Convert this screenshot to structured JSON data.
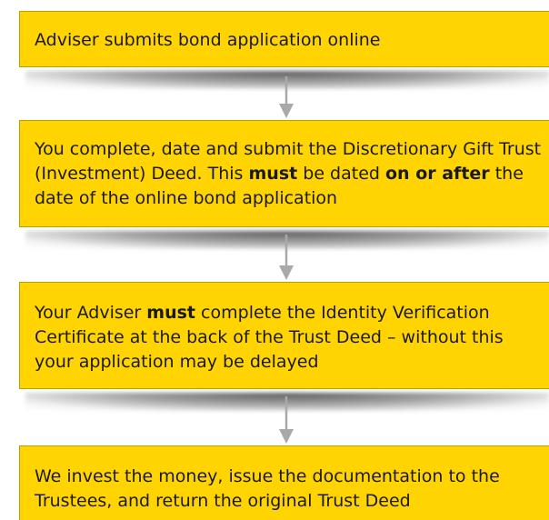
{
  "steps": [
    {
      "parts": [
        {
          "text": "Adviser submits bond application online",
          "bold": false
        }
      ]
    },
    {
      "parts": [
        {
          "text": "You complete, date and submit the Discretionary Gift Trust (Investment) Deed. This ",
          "bold": false
        },
        {
          "text": "must",
          "bold": true
        },
        {
          "text": " be dated ",
          "bold": false
        },
        {
          "text": "on or after",
          "bold": true
        },
        {
          "text": " the date of the online bond application",
          "bold": false
        }
      ]
    },
    {
      "parts": [
        {
          "text": "Your Adviser ",
          "bold": false
        },
        {
          "text": "must",
          "bold": true
        },
        {
          "text": " complete the Identity Verification Certificate at the back of the Trust Deed – without this your application may be delayed",
          "bold": false
        }
      ]
    },
    {
      "parts": [
        {
          "text": "We invest the money, issue the documentation to the Trustees, and return the original Trust Deed",
          "bold": false
        }
      ]
    }
  ],
  "colors": {
    "box_fill": "#ffd400",
    "arrow": "#a9a9a9",
    "text": "#1a1a1a"
  }
}
